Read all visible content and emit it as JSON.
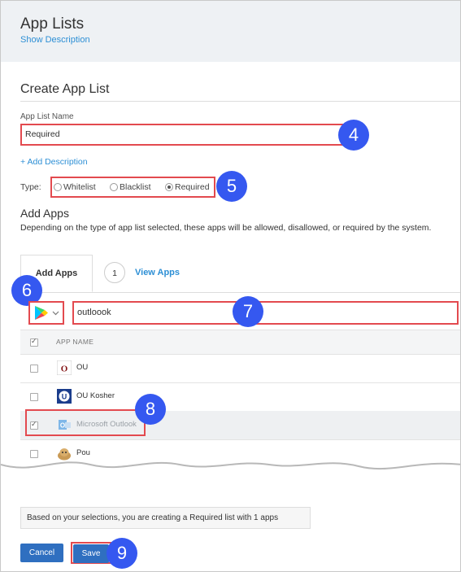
{
  "header": {
    "title": "App Lists",
    "show_description": "Show Description"
  },
  "form": {
    "section_title": "Create App List",
    "name_label": "App List Name",
    "name_value": "Required",
    "add_description": "+ Add Description",
    "type_label": "Type:",
    "type_options": [
      "Whitelist",
      "Blacklist",
      "Required"
    ],
    "type_selected": "Required"
  },
  "add_apps": {
    "heading": "Add Apps",
    "description": "Depending on the type of app list selected, these apps will be allowed, disallowed, or required by the system.",
    "tabs": {
      "active": "Add Apps",
      "count": "1",
      "view": "View Apps"
    },
    "search_value": "outloook",
    "column_header": "APP NAME",
    "rows": [
      {
        "name": "OU",
        "checked": false
      },
      {
        "name": "OU Kosher",
        "checked": false
      },
      {
        "name": "Microsoft Outlook",
        "checked": true
      },
      {
        "name": "Pou",
        "checked": false
      }
    ]
  },
  "footer": {
    "summary": "Based on your selections, you are creating a Required list with 1 apps",
    "cancel": "Cancel",
    "save": "Save"
  },
  "callouts": [
    "4",
    "5",
    "6",
    "7",
    "8",
    "9"
  ],
  "colors": {
    "accent": "#2d8fd5",
    "highlight": "#e34a4f",
    "callout": "#3558f0",
    "button": "#2f6fc0"
  }
}
